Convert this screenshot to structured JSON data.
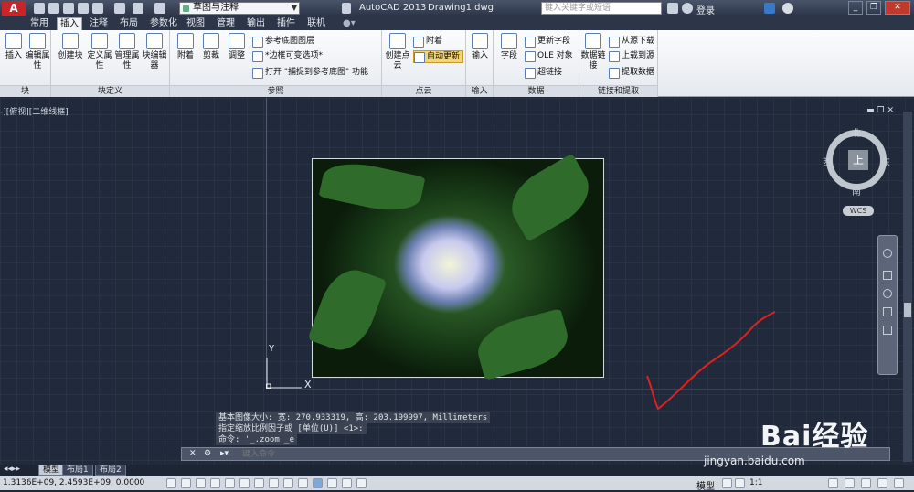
{
  "titlebar": {
    "logo": "A",
    "workspace": "草图与注释",
    "app_title": "AutoCAD 2013",
    "doc_title": "Drawing1.dwg",
    "search_placeholder": "键入关键字或短语",
    "login": "登录"
  },
  "tabs": [
    "常用",
    "插入",
    "注释",
    "布局",
    "参数化",
    "视图",
    "管理",
    "输出",
    "插件",
    "联机"
  ],
  "active_tab": "插入",
  "ribbon": {
    "panels": [
      {
        "title": "块",
        "buttons": [
          "插入",
          "编辑属性"
        ]
      },
      {
        "title": "块定义",
        "buttons": [
          "创建块",
          "定义属性",
          "管理属性",
          "块编辑器"
        ]
      },
      {
        "title": "参照",
        "buttons": [
          "附着",
          "剪裁",
          "调整"
        ],
        "small": [
          "参考底图图层",
          "*边框可变选项*",
          "打开 \"捕捉到参考底图\" 功能"
        ]
      },
      {
        "title": "点云",
        "buttons": [
          "创建点云"
        ],
        "small": [
          "附着",
          "自动更新"
        ]
      },
      {
        "title": "输入",
        "buttons": [
          "输入"
        ]
      },
      {
        "title": "数据",
        "buttons": [
          "字段"
        ],
        "small": [
          "更新字段",
          "OLE 对象",
          "超链接"
        ]
      },
      {
        "title": "链接和提取",
        "buttons": [
          "数据链接"
        ],
        "small": [
          "从源下载",
          "上载到源",
          "提取数据"
        ]
      }
    ]
  },
  "viewport": {
    "label": "-][俯视][二维线框]",
    "compass": {
      "north": "北",
      "south": "南",
      "east": "东",
      "west": "西",
      "face": "上",
      "wcs": "WCS"
    },
    "ucs": {
      "x": "X",
      "y": "Y"
    }
  },
  "command": {
    "history": [
      "基本图像大小: 宽: 270.933319, 高: 203.199997, Millimeters",
      "指定缩放比例因子或 [单位(U)] <1>:",
      "命令: '_.zoom _e"
    ],
    "placeholder": "键入命令"
  },
  "layout_tabs": [
    "模型",
    "布局1",
    "布局2"
  ],
  "statusbar": {
    "coords": "1.3136E+09, 2.4593E+09, 0.0000",
    "model": "模型",
    "scale": "1:1"
  },
  "watermark": {
    "brand": "Bai经验",
    "url": "jingyan.baidu.com"
  },
  "colors": {
    "accent": "#c8242a",
    "canvas": "#212a3b",
    "annotation": "#e02020"
  }
}
